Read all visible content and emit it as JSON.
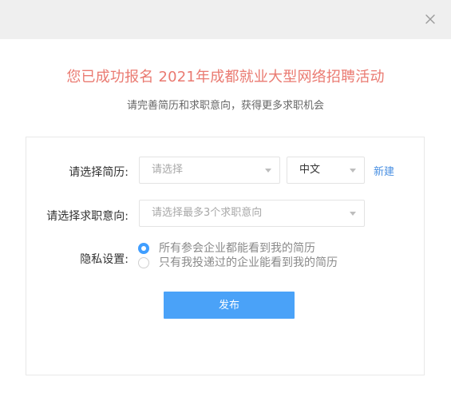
{
  "dialog": {
    "title": "您已成功报名 2021年成都就业大型网络招聘活动",
    "subtitle": "请完善简历和求职意向，获得更多求职机会"
  },
  "form": {
    "resume_label": "请选择简历:",
    "resume_placeholder": "请选择",
    "language_value": "中文",
    "new_link": "新建",
    "intent_label": "请选择求职意向:",
    "intent_placeholder": "请选择最多3个求职意向",
    "privacy_label": "隐私设置:",
    "privacy_options": [
      {
        "label": "所有参会企业都能看到我的简历",
        "checked": true
      },
      {
        "label": "只有我投递过的企业能看到我的简历",
        "checked": false
      }
    ],
    "publish_label": "发布"
  },
  "colors": {
    "title": "#ea7a71",
    "primary": "#4aa2f8",
    "radio_checked": "#409eff",
    "link": "#4a90e2",
    "topbar": "#efefef"
  },
  "icons": {
    "close": "close-icon",
    "dropdown": "caret-down-icon"
  }
}
